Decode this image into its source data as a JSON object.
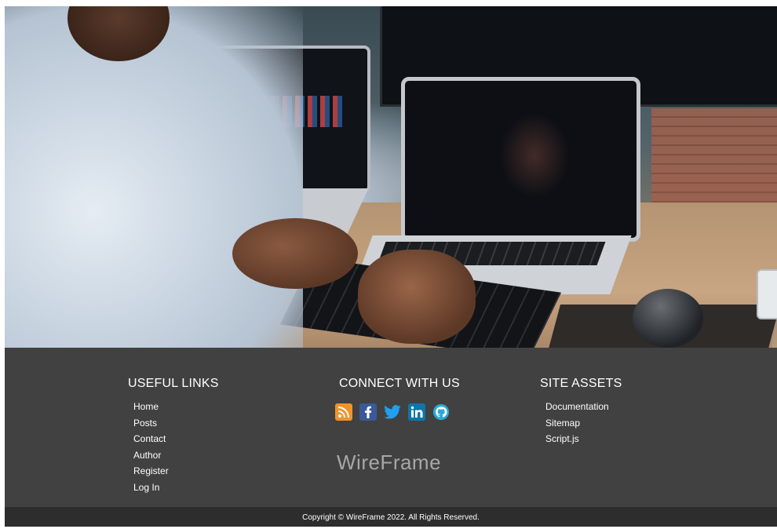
{
  "footer": {
    "useful_links": {
      "title": "USEFUL LINKS",
      "items": [
        "Home",
        "Posts",
        "Contact",
        "Author",
        "Register",
        "Log In"
      ]
    },
    "connect": {
      "title": "CONNECT WITH US",
      "icons": [
        "rss-icon",
        "facebook-icon",
        "twitter-icon",
        "linkedin-icon",
        "github-icon"
      ]
    },
    "brand": "WireFrame",
    "site_assets": {
      "title": "SITE ASSETS",
      "items": [
        "Documentation",
        "Sitemap",
        "Script.js"
      ]
    },
    "copyright": "Copyright © WireFrame 2022. All Rights Reserved."
  },
  "colors": {
    "footer_bg": "#414141",
    "copyright_bg": "#2d2d2d",
    "brand_text": "#a7a7a7"
  }
}
